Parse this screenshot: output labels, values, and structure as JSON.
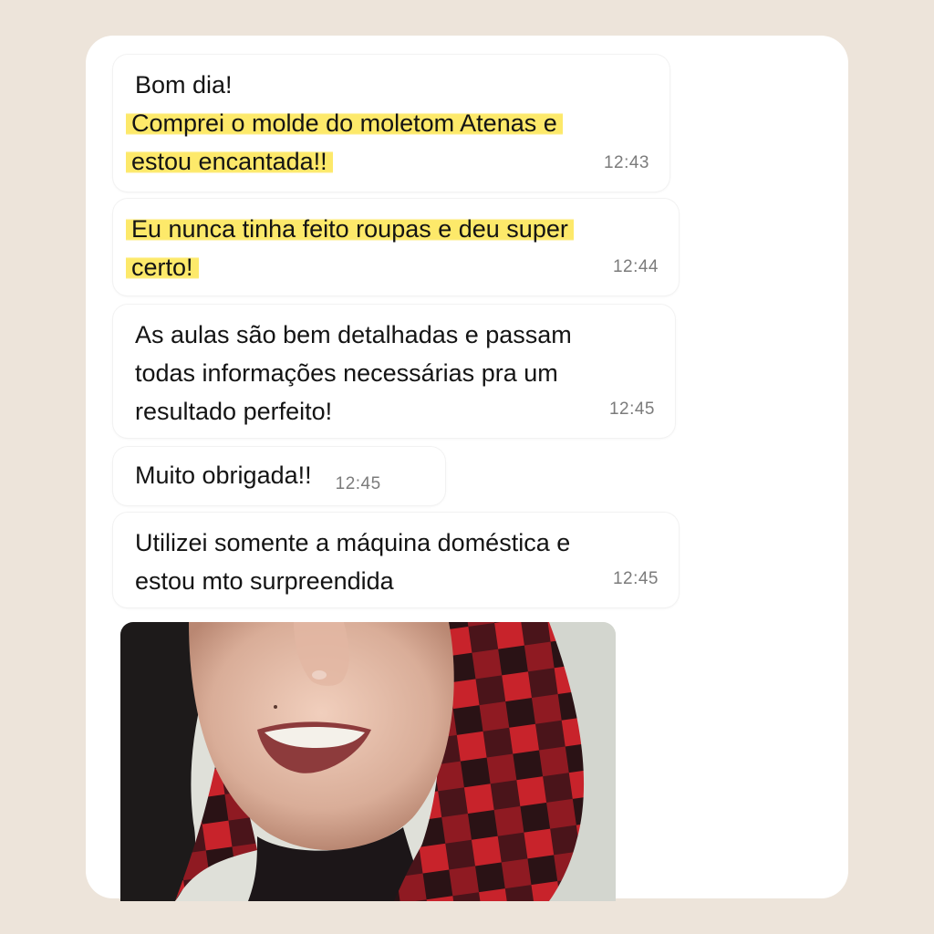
{
  "chat": {
    "messages": [
      {
        "lines": [
          {
            "text": "Bom dia!",
            "highlight": false
          },
          {
            "text": "Comprei o molde do moletom Atenas e",
            "highlight": true
          },
          {
            "text": "estou encantada!!",
            "highlight": true
          }
        ],
        "time": "12:43"
      },
      {
        "lines": [
          {
            "text": "Eu nunca tinha feito roupas e deu super",
            "highlight": true
          },
          {
            "text": "certo!",
            "highlight": true
          }
        ],
        "time": "12:44"
      },
      {
        "lines": [
          {
            "text": "As aulas são bem detalhadas e passam",
            "highlight": false
          },
          {
            "text": "todas informações necessárias pra um",
            "highlight": false
          },
          {
            "text": "resultado perfeito!",
            "highlight": false
          }
        ],
        "time": "12:45"
      },
      {
        "lines": [
          {
            "text": "Muito obrigada!!",
            "highlight": false
          }
        ],
        "time": "12:45"
      },
      {
        "lines": [
          {
            "text": "Utilizei somente a máquina doméstica e",
            "highlight": false
          },
          {
            "text": "estou mto surpreendida",
            "highlight": false
          }
        ],
        "time": "12:45"
      }
    ],
    "highlight_color": "#fde96a",
    "photo": {
      "subject": "smiling woman wearing red and black checkered hood"
    }
  }
}
